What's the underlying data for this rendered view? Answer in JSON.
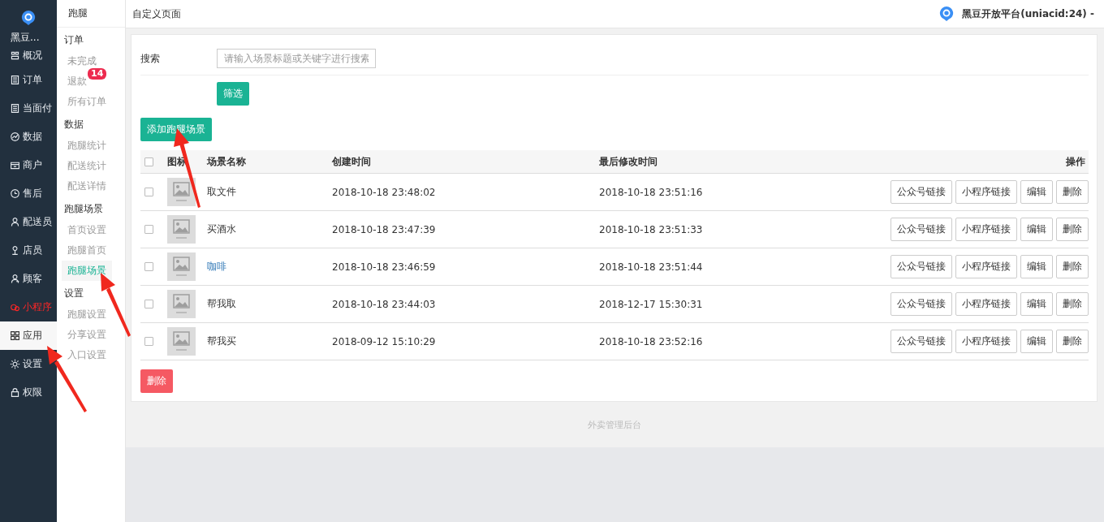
{
  "brand": {
    "name": "黑豆..."
  },
  "nav": [
    {
      "label": "概况",
      "selected": false,
      "alert": false
    },
    {
      "label": "订单",
      "selected": false,
      "alert": false
    },
    {
      "label": "当面付",
      "selected": false,
      "alert": false
    },
    {
      "label": "数据",
      "selected": false,
      "alert": false
    },
    {
      "label": "商户",
      "selected": false,
      "alert": false
    },
    {
      "label": "售后",
      "selected": false,
      "alert": false
    },
    {
      "label": "配送员",
      "selected": false,
      "alert": false
    },
    {
      "label": "店员",
      "selected": false,
      "alert": false
    },
    {
      "label": "顾客",
      "selected": false,
      "alert": false
    },
    {
      "label": "小程序",
      "selected": false,
      "alert": true
    },
    {
      "label": "应用",
      "selected": true,
      "alert": false
    },
    {
      "label": "设置",
      "selected": false,
      "alert": false
    },
    {
      "label": "权限",
      "selected": false,
      "alert": false
    }
  ],
  "subnav": {
    "title": "跑腿",
    "groups": [
      {
        "title": "订单",
        "items": [
          {
            "label": "未完成",
            "selected": false
          },
          {
            "label": "退款",
            "selected": false,
            "badge": "14"
          },
          {
            "label": "所有订单",
            "selected": false
          }
        ]
      },
      {
        "title": "数据",
        "items": [
          {
            "label": "跑腿统计",
            "selected": false
          },
          {
            "label": "配送统计",
            "selected": false
          },
          {
            "label": "配送详情",
            "selected": false
          }
        ]
      },
      {
        "title": "跑腿场景",
        "items": [
          {
            "label": "首页设置",
            "selected": false
          },
          {
            "label": "跑腿首页",
            "selected": false
          },
          {
            "label": "跑腿场景",
            "selected": true
          }
        ]
      },
      {
        "title": "设置",
        "items": [
          {
            "label": "跑腿设置",
            "selected": false
          },
          {
            "label": "分享设置",
            "selected": false
          },
          {
            "label": "入口设置",
            "selected": false
          }
        ]
      }
    ]
  },
  "topbar": {
    "title": "自定义页面",
    "account": "黑豆开放平台(uniacid:24)",
    "caret": "-"
  },
  "search": {
    "label": "搜索",
    "placeholder": "请输入场景标题或关键字进行搜索",
    "button": "筛选"
  },
  "add_button": "添加跑腿场景",
  "table": {
    "columns": [
      "图标",
      "场景名称",
      "创建时间",
      "最后修改时间",
      "操作"
    ],
    "header_checked": false,
    "rows": [
      {
        "checked": false,
        "name": "取文件",
        "hovered": false,
        "created": "2018-10-18 23:48:02",
        "modified": "2018-10-18 23:51:16",
        "actions": [
          "公众号链接",
          "小程序链接",
          "编辑",
          "删除"
        ]
      },
      {
        "checked": false,
        "name": "买酒水",
        "hovered": false,
        "created": "2018-10-18 23:47:39",
        "modified": "2018-10-18 23:51:33",
        "actions": [
          "公众号链接",
          "小程序链接",
          "编辑",
          "删除"
        ]
      },
      {
        "checked": false,
        "name": "咖啡",
        "hovered": true,
        "created": "2018-10-18 23:46:59",
        "modified": "2018-10-18 23:51:44",
        "actions": [
          "公众号链接",
          "小程序链接",
          "编辑",
          "删除"
        ]
      },
      {
        "checked": false,
        "name": "帮我取",
        "hovered": false,
        "created": "2018-10-18 23:44:03",
        "modified": "2018-12-17 15:30:31",
        "actions": [
          "公众号链接",
          "小程序链接",
          "编辑",
          "删除"
        ]
      },
      {
        "checked": false,
        "name": "帮我买",
        "hovered": false,
        "created": "2018-09-12 15:10:29",
        "modified": "2018-10-18 23:52:16",
        "actions": [
          "公众号链接",
          "小程序链接",
          "编辑",
          "删除"
        ]
      }
    ]
  },
  "delete_button": "删除",
  "footer": "外卖管理后台"
}
